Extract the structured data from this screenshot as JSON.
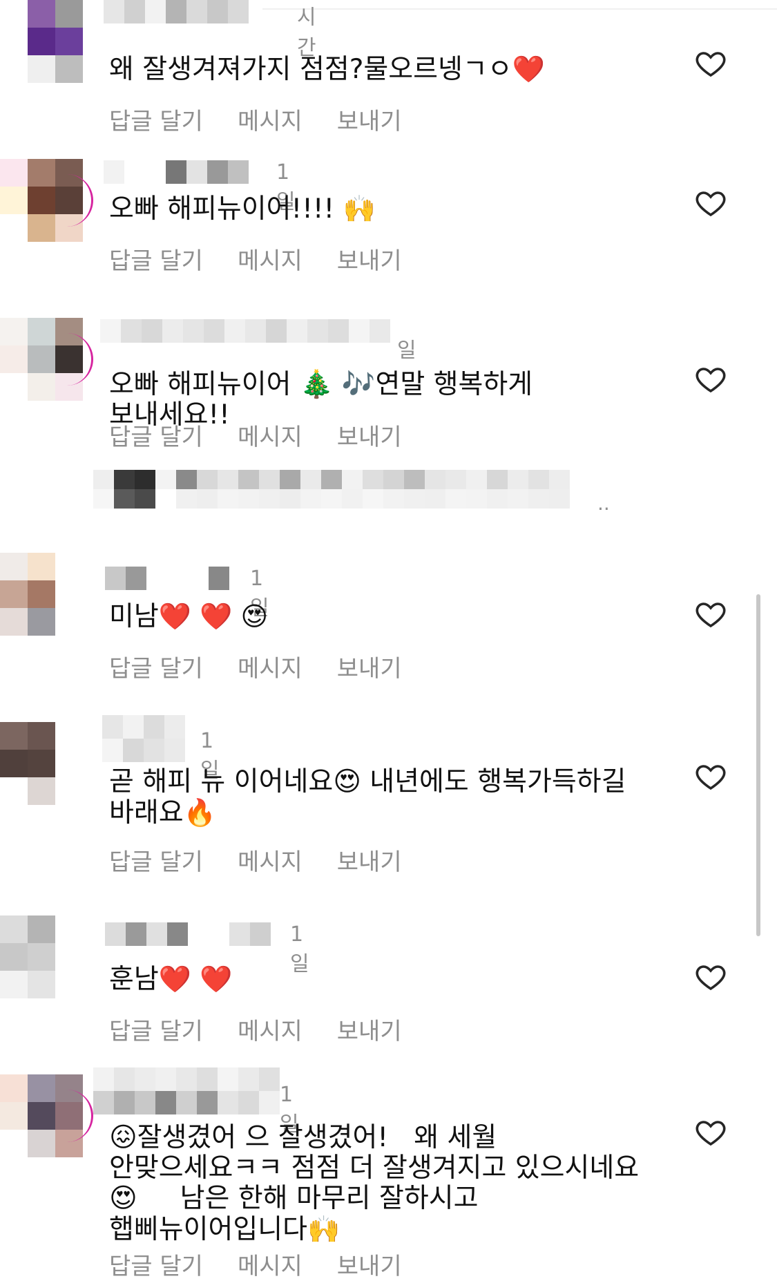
{
  "comments": [
    {
      "time": "시간",
      "text": "왜 잘생겨져가지 점점?물오르넹ㄱㅇ",
      "emoji": "❤️",
      "avatar_colors": [
        "#3d1a6e",
        "#8b5fa8",
        "#ffffff",
        "#5a2a8a",
        "#6b3f9c",
        "#c9c9c9",
        "#ffffff",
        "#efefef",
        "#bdbdbd"
      ]
    },
    {
      "time": "1일",
      "text": "오빠 해피뉴이어!!!! ",
      "emoji": "🙌",
      "avatar_colors": [
        "#f7dbe5",
        "#fbe6ee",
        "#ffffff",
        "#a37c6b",
        "#7a5c52",
        "#ffffff",
        "#6e4030",
        "#5a4038",
        "#fff4d8",
        "#d9b48e",
        "#f0d6c7",
        "#ffffff"
      ]
    },
    {
      "time": "일",
      "text": "오빠 해피뉴이어 🎄 🎶연말 행복하게 보내세요!!",
      "emoji": "",
      "avatar_colors": [
        "#f6ece8",
        "#f5f2ef",
        "#ffffff",
        "#cfd6d6",
        "#a48d82",
        "#ffffff",
        "#b9bcbd",
        "#3a3230",
        "#ffffff"
      ]
    },
    {
      "time": "1일",
      "text": "미남",
      "emoji": "❤️ ❤️ 😍",
      "avatar_colors": [
        "#f0ebe8",
        "#f6e2cc",
        "#ffffff",
        "#c7a595",
        "#a57865",
        "#ffffff",
        "#e5dbd8",
        "#9a9aa0",
        "#ffffff"
      ]
    },
    {
      "time": "1일",
      "text": "곧 해피 뉴 이어네요😍 내년에도 행복가득하길 바래요",
      "emoji": "🔥",
      "avatar_colors": [
        "#7c6660",
        "#6a5550",
        "#ffffff",
        "#50403c",
        "#54433e",
        "#ffffff",
        "#ffffff",
        "#ddd6d3",
        "#ffffff"
      ]
    },
    {
      "time": "1일",
      "text": "훈남",
      "emoji": "❤️ ❤️",
      "avatar_colors": [
        "#dcdcdc",
        "#b4b4b4",
        "#ffffff",
        "#c8c8c8",
        "#cfcfcf",
        "#ffffff",
        "#f2f2f2",
        "#e4e4e4",
        "#ffffff"
      ]
    },
    {
      "time": "1일",
      "text": "😖잘생겼어 으 잘생겼어!   왜 세월 안맞으세요ㅋㅋ 점점 더 잘생겨지고 있으시네요😍     남은 한해 마무리 잘하시고 햅삐뉴이어입니다",
      "emoji": "🙌",
      "avatar_colors": [
        "#f7e0d6",
        "#9891a3",
        "#95838a",
        "#f4e9e0",
        "#544a5c",
        "#8f6f76",
        "#ffffff",
        "#d9d3d3",
        "#c8a29a"
      ]
    }
  ],
  "actions": {
    "reply": "답글 달기",
    "message": "메시지",
    "send": "보내기"
  },
  "more": "..",
  "colors": {
    "secondary_text": "#8e8e8e",
    "story_ring": "#d6249f"
  },
  "icons": {
    "like": "heart-outline-icon"
  }
}
